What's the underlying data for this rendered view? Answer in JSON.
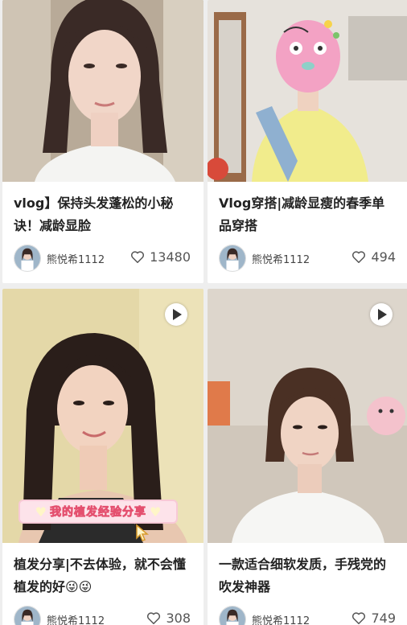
{
  "feed": {
    "cards": [
      {
        "title": "vlog】保持头发蓬松的小秘诀！减龄显脸",
        "author": "熊悦希1112",
        "likes": "13480",
        "has_video": false
      },
      {
        "title": "Vlog穿搭|减龄显瘦的春季单品穿搭",
        "author": "熊悦希1112",
        "likes": "494",
        "has_video": false
      },
      {
        "title": "植发分享|不去体验，就不会懂植发的好😜😜",
        "author": "熊悦希1112",
        "likes": "308",
        "has_video": true,
        "cover_text": "我的植发经验分享"
      },
      {
        "title": "一款适合细软发质，手残党的吹发神器",
        "author": "熊悦希1112",
        "likes": "749",
        "has_video": true
      }
    ]
  },
  "colors": {
    "background": "#eeeeee",
    "card": "#ffffff",
    "title_text": "#222222",
    "meta_text": "#555555"
  },
  "icons": {
    "like": "heart-outline-icon",
    "video": "play-icon",
    "banner_decor": "heart-icon"
  }
}
